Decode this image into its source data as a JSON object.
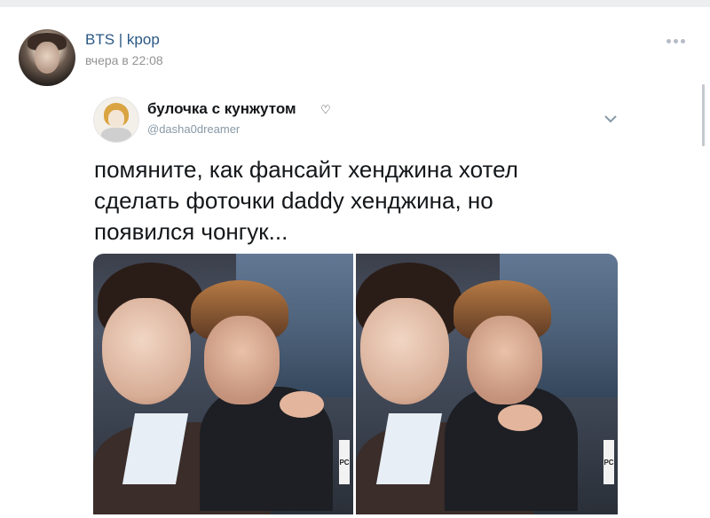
{
  "post": {
    "group_name": "BTS | kpop",
    "time": "вчера в 22:08",
    "more_icon": "more-horizontal-icon"
  },
  "tweet": {
    "display_name": "булочка с кунжутом",
    "name_emoji": "♡",
    "handle": "@dasha0dreamer",
    "text": "помяните, как фансайт хенджина хотел\nсделать фоточки daddy хенджина, но\nпоявился чонгук...",
    "photo_tag": "PC"
  },
  "colors": {
    "link": "#2a5885",
    "muted": "#939393",
    "page_bg": "#edeef0",
    "tweet_text": "#14171a",
    "handle": "#8899a6"
  }
}
